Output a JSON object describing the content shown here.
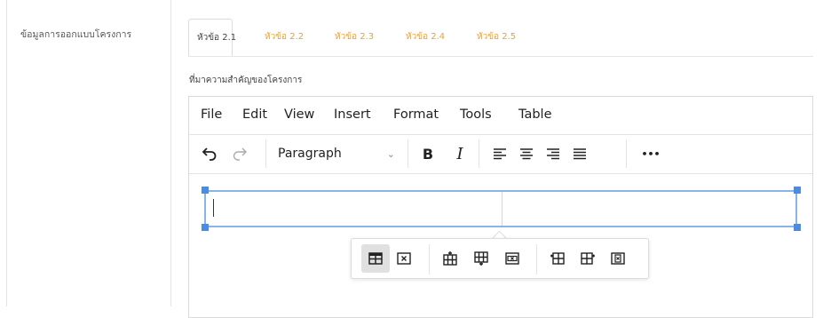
{
  "section": {
    "label": "ข้อมูลการออกแบบโครงการ"
  },
  "tabs": [
    {
      "label": "หัวข้อ 2.1",
      "active": true
    },
    {
      "label": "หัวข้อ 2.2"
    },
    {
      "label": "หัวข้อ 2.3"
    },
    {
      "label": "หัวข้อ 2.4"
    },
    {
      "label": "หัวข้อ 2.5"
    }
  ],
  "field": {
    "label": "ที่มาความสำคัญของโครงการ"
  },
  "editor": {
    "menu": [
      "File",
      "Edit",
      "View",
      "Insert",
      "Format",
      "Tools",
      "Table"
    ],
    "toolbar": {
      "block_format": "Paragraph",
      "bold_label": "B",
      "italic_label": "I",
      "more_label": "•••"
    },
    "table_toolbar": {
      "icons": [
        "table-properties-icon",
        "delete-table-icon",
        "insert-row-before-icon",
        "insert-row-after-icon",
        "delete-row-icon",
        "insert-column-before-icon",
        "insert-column-after-icon",
        "delete-column-icon"
      ],
      "active": "table-properties-icon"
    }
  },
  "colors": {
    "tab_inactive": "#f0a030",
    "selection": "#4a8de0"
  }
}
